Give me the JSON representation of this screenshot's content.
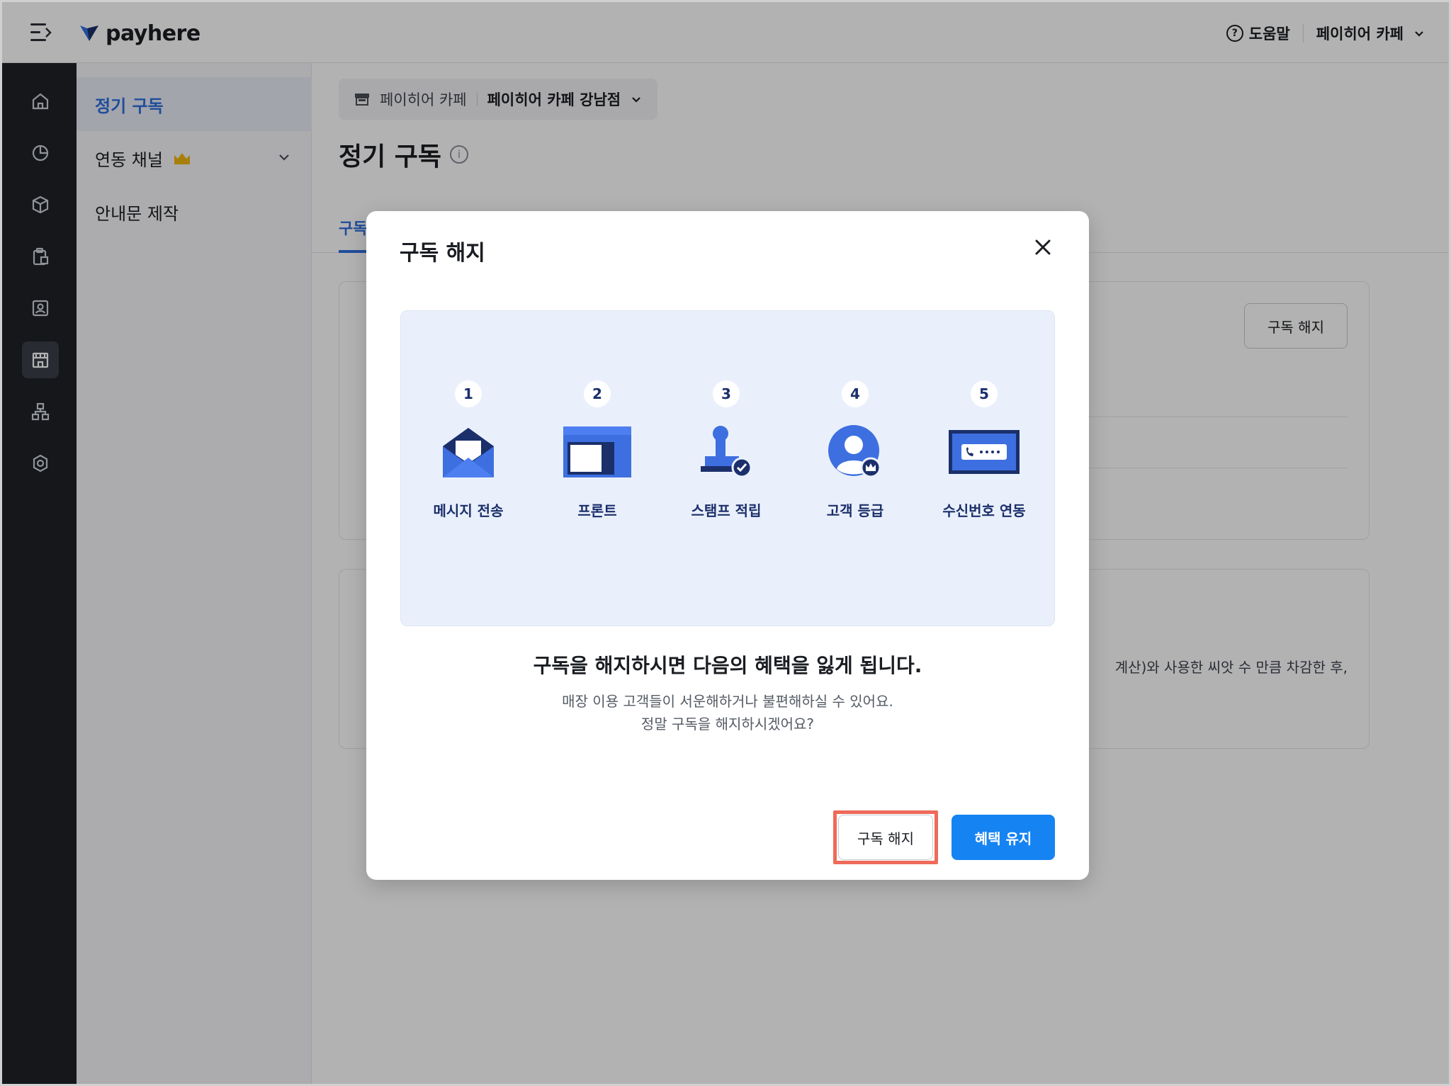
{
  "header": {
    "logo_text": "payhere",
    "help_label": "도움말",
    "store_name": "페이히어 카페",
    "brand_color": "#2f6fe0"
  },
  "sidebar": {
    "items": [
      {
        "label": "정기 구독",
        "active": true
      },
      {
        "label": "연동 채널",
        "active": false
      },
      {
        "label": "안내문 제작",
        "active": false
      }
    ]
  },
  "rail": {
    "icons": [
      "home-icon",
      "chart-icon",
      "box-icon",
      "clipboard-icon",
      "contact-icon",
      "store-icon",
      "org-icon",
      "settings-icon"
    ],
    "active_icon": "store-icon"
  },
  "main": {
    "store_selector": {
      "brand": "페이히어 카페",
      "branch": "페이히어 카페 강남점"
    },
    "page_title": "정기 구독",
    "tab_label": "구독",
    "card1_button": "구독 해지",
    "card2_text": "계산)와 사용한 씨앗 수 만큼 차감한 후,"
  },
  "modal": {
    "title": "구독 해지",
    "benefits": [
      {
        "num": "1",
        "label": "메시지 전송",
        "icon": "envelope-icon"
      },
      {
        "num": "2",
        "label": "프론트",
        "icon": "front-display-icon"
      },
      {
        "num": "3",
        "label": "스탬프 적립",
        "icon": "stamp-icon"
      },
      {
        "num": "4",
        "label": "고객 등급",
        "icon": "customer-grade-icon"
      },
      {
        "num": "5",
        "label": "수신번호 연동",
        "icon": "phone-number-icon"
      }
    ],
    "heading": "구독을 해지하시면 다음의 혜택을 잃게 됩니다.",
    "desc_line1": "매장 이용 고객들이 서운해하거나 불편해하실 수 있어요.",
    "desc_line2": "정말 구독을 해지하시겠어요?",
    "cancel_label": "구독 해지",
    "keep_label": "혜택 유지",
    "primary_color": "#1683f3",
    "highlight_color": "#ee6a5a"
  }
}
